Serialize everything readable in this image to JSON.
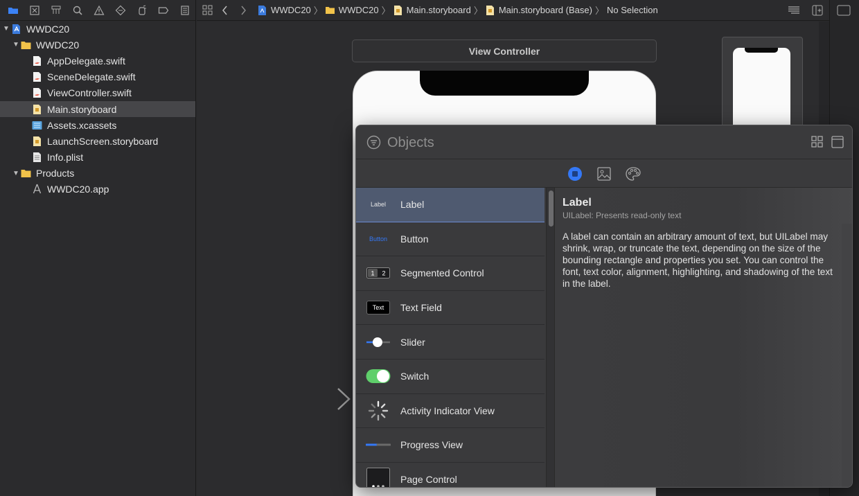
{
  "navigator": {
    "toolbar_icons": [
      "folder-icon",
      "source-control-icon",
      "symbol-hierarchy-icon",
      "find-icon",
      "issue-warning-icon",
      "test-diamond-icon",
      "debug-gauge-icon",
      "breakpoint-icon",
      "report-icon"
    ],
    "tree": [
      {
        "label": "WWDC20",
        "icon": "project-icon",
        "level": 0,
        "disclosure": "open"
      },
      {
        "label": "WWDC20",
        "icon": "folder-icon",
        "level": 1,
        "disclosure": "open"
      },
      {
        "label": "AppDelegate.swift",
        "icon": "swift-file-icon",
        "level": 2
      },
      {
        "label": "SceneDelegate.swift",
        "icon": "swift-file-icon",
        "level": 2
      },
      {
        "label": "ViewController.swift",
        "icon": "swift-file-icon",
        "level": 2
      },
      {
        "label": "Main.storyboard",
        "icon": "storyboard-file-icon",
        "level": 2,
        "selected": true
      },
      {
        "label": "Assets.xcassets",
        "icon": "asset-catalog-icon",
        "level": 2
      },
      {
        "label": "LaunchScreen.storyboard",
        "icon": "storyboard-file-icon",
        "level": 2
      },
      {
        "label": "Info.plist",
        "icon": "plist-file-icon",
        "level": 2
      },
      {
        "label": "Products",
        "icon": "folder-icon",
        "level": 1,
        "disclosure": "open"
      },
      {
        "label": "WWDC20.app",
        "icon": "app-product-icon",
        "level": 2
      }
    ]
  },
  "jumpbar": {
    "crumbs": [
      {
        "label": "WWDC20",
        "icon": "project-icon"
      },
      {
        "label": "WWDC20",
        "icon": "folder-icon"
      },
      {
        "label": "Main.storyboard",
        "icon": "storyboard-file-icon"
      },
      {
        "label": "Main.storyboard (Base)",
        "icon": "storyboard-file-icon"
      },
      {
        "label": "No Selection",
        "icon": ""
      }
    ]
  },
  "canvas": {
    "scene_title": "View Controller"
  },
  "library": {
    "search_placeholder": "Objects",
    "tabs": [
      "objects-tab-icon",
      "media-tab-icon",
      "colors-tab-icon"
    ],
    "active_tab": 0,
    "items": [
      {
        "name": "Label",
        "thumb": "Label",
        "selected": true
      },
      {
        "name": "Button",
        "thumb": "Button"
      },
      {
        "name": "Segmented Control",
        "thumb": "1 2"
      },
      {
        "name": "Text Field",
        "thumb": "Text"
      },
      {
        "name": "Slider",
        "thumb": ""
      },
      {
        "name": "Switch",
        "thumb": ""
      },
      {
        "name": "Activity Indicator View",
        "thumb": ""
      },
      {
        "name": "Progress View",
        "thumb": ""
      },
      {
        "name": "Page Control",
        "thumb": ""
      }
    ],
    "detail": {
      "title": "Label",
      "subtitle": "UILabel: Presents read-only text",
      "description": "A label can contain an arbitrary amount of text, but UILabel may shrink, wrap, or truncate the text, depending on the size of the bounding rectangle and properties you set. You can control the font, text color, alignment, highlighting, and shadowing of the text in the label."
    }
  },
  "colors": {
    "accent": "#3478f6",
    "switch_on": "#5fcf6b",
    "selection": "#4f5a70"
  }
}
